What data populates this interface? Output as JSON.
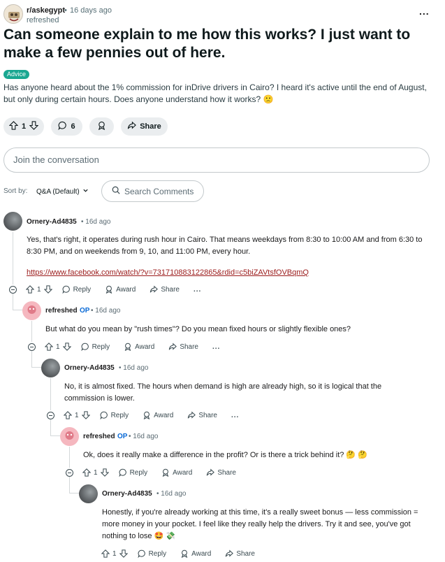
{
  "post": {
    "subreddit": "r/askegypt",
    "time": "16 days ago",
    "author": "refreshed",
    "title": "Can someone explain to me how this works? I just want to make a few pennies out of here.",
    "flair": "Advice",
    "body": "Has anyone heard about the 1% commission for inDrive drivers in Cairo? I heard it's active until the end of August, but only during certain hours. Does anyone understand how it works? 🙁",
    "votes": "1",
    "comments": "6",
    "share_label": "Share"
  },
  "join": {
    "placeholder": "Join the conversation"
  },
  "sort": {
    "label": "Sort by:",
    "value": "Q&A (Default)"
  },
  "search": {
    "label": "Search Comments"
  },
  "labels": {
    "reply": "Reply",
    "award": "Award",
    "share": "Share",
    "op": "OP",
    "dot": "•",
    "more": "..."
  },
  "comments": [
    {
      "author": "Ornery-Ad4835",
      "time": "16d ago",
      "text": "Yes, that's right, it operates during rush hour in Cairo. That means weekdays from 8:30 to 10:00 AM and from 6:30 to 8:30 PM, and on weekends from 9, 10, and 11:00 PM, every hour.",
      "link": "https://www.facebook.com/watch/?v=731710883122865&rdid=c5biZAVtsfOVBqmQ",
      "votes": "1"
    },
    {
      "author": "refreshed",
      "time": "16d ago",
      "text": "But what do you mean by \"rush times\"? Do you mean fixed hours or slightly flexible ones?",
      "votes": "1"
    },
    {
      "author": "Ornery-Ad4835",
      "time": "16d ago",
      "text": "No, it is almost fixed. The hours when demand is high are already high, so it is logical that the commission is lower.",
      "votes": "1"
    },
    {
      "author": "refreshed",
      "time": "16d ago",
      "text": "Ok, does it really make a difference in the profit? Or is there a trick behind it? 🤔 🤔",
      "votes": "1"
    },
    {
      "author": "Ornery-Ad4835",
      "time": "16d ago",
      "text": "Honestly, if you're already working at this time, it's a really sweet bonus — less commission = more money in your pocket. I feel like they really help the drivers. Try it and see, you've got nothing to lose 🤩 💸",
      "votes": "1"
    }
  ]
}
